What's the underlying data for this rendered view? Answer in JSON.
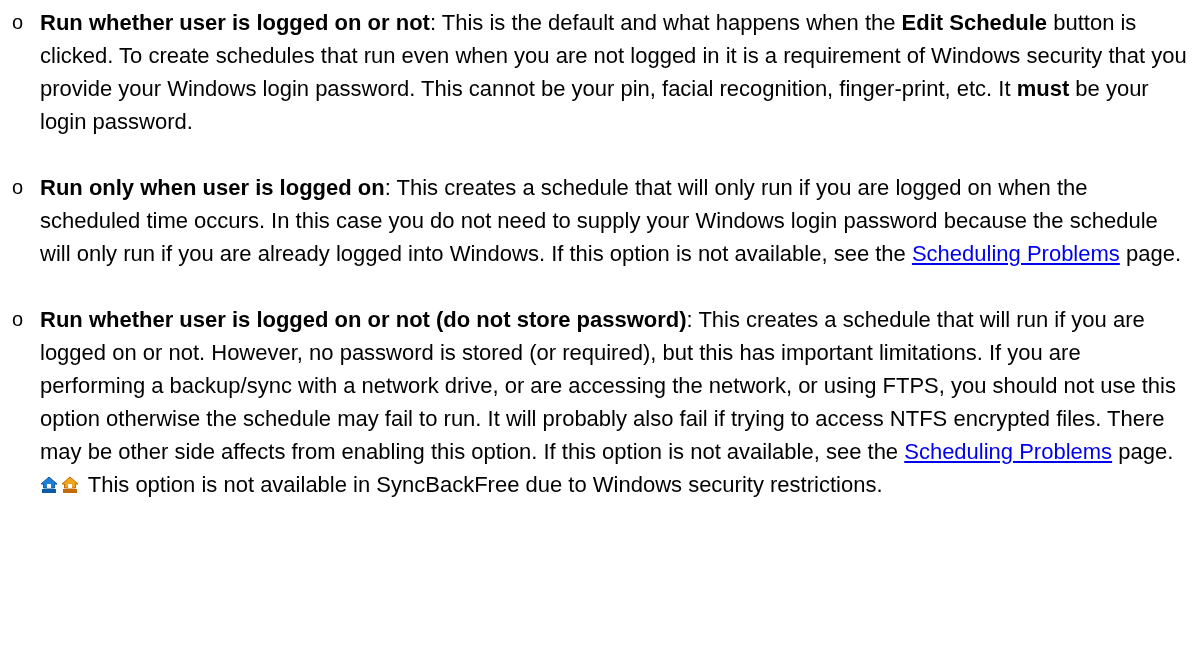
{
  "items": [
    {
      "bullet": "o",
      "segments": [
        {
          "kind": "text",
          "text": "**Run whether user is logged on or not**: This is the default and what happens when the **Edit Schedule** button is clicked. To create schedules that run even when you are not logged in it is a requirement of Windows security that you provide your Windows login password. This cannot be your pin, facial recognition, finger-print, etc. It **must** be your login password."
        }
      ]
    },
    {
      "bullet": "o",
      "segments": [
        {
          "kind": "text",
          "text": "**Run only when user is logged on**: This creates a schedule that will only run if you are logged on when the scheduled time occurs. In this case you do not need to supply your Windows login password because the schedule will only run if you are already logged into Windows. If this option is not available, see the "
        },
        {
          "kind": "link",
          "text": "Scheduling Problems"
        },
        {
          "kind": "text",
          "text": " page."
        }
      ]
    },
    {
      "bullet": "o",
      "segments": [
        {
          "kind": "text",
          "text": "**Run whether user is logged on or not (do not store password)**: This creates a schedule that will run if you are logged on or not. However, no password is stored (or required), but this has important limitations. If you are performing a backup/sync with a network drive, or are accessing the network, or using FTPS, you should not use this option otherwise the schedule may fail to run. It will probably also fail if trying to access NTFS encrypted files. There may be other side affects from enabling this option. If this option is not available, see the "
        },
        {
          "kind": "link",
          "text": "Scheduling Problems"
        },
        {
          "kind": "text",
          "text": " page. "
        },
        {
          "kind": "icon"
        },
        {
          "kind": "icon"
        },
        {
          "kind": "text",
          "text": " This option is not available in SyncBackFree due to Windows security restrictions."
        }
      ]
    }
  ]
}
